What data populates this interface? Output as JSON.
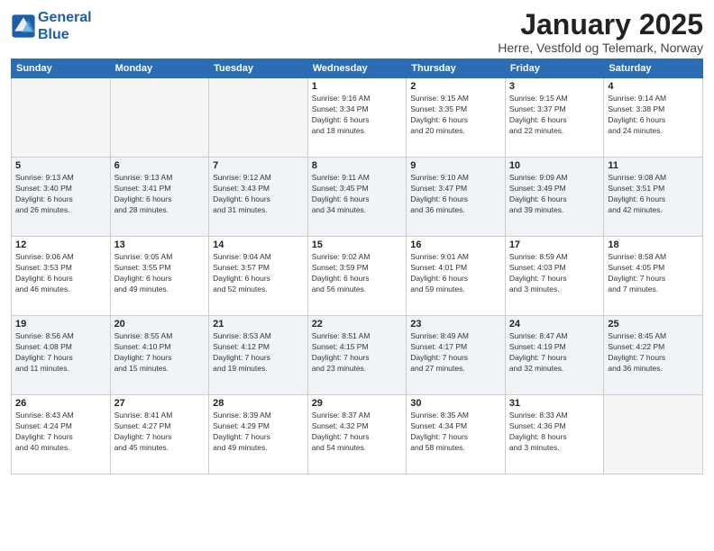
{
  "header": {
    "logo_line1": "General",
    "logo_line2": "Blue",
    "title": "January 2025",
    "subtitle": "Herre, Vestfold og Telemark, Norway"
  },
  "weekdays": [
    "Sunday",
    "Monday",
    "Tuesday",
    "Wednesday",
    "Thursday",
    "Friday",
    "Saturday"
  ],
  "weeks": [
    [
      {
        "day": "",
        "info": ""
      },
      {
        "day": "",
        "info": ""
      },
      {
        "day": "",
        "info": ""
      },
      {
        "day": "1",
        "info": "Sunrise: 9:16 AM\nSunset: 3:34 PM\nDaylight: 6 hours\nand 18 minutes."
      },
      {
        "day": "2",
        "info": "Sunrise: 9:15 AM\nSunset: 3:35 PM\nDaylight: 6 hours\nand 20 minutes."
      },
      {
        "day": "3",
        "info": "Sunrise: 9:15 AM\nSunset: 3:37 PM\nDaylight: 6 hours\nand 22 minutes."
      },
      {
        "day": "4",
        "info": "Sunrise: 9:14 AM\nSunset: 3:38 PM\nDaylight: 6 hours\nand 24 minutes."
      }
    ],
    [
      {
        "day": "5",
        "info": "Sunrise: 9:13 AM\nSunset: 3:40 PM\nDaylight: 6 hours\nand 26 minutes."
      },
      {
        "day": "6",
        "info": "Sunrise: 9:13 AM\nSunset: 3:41 PM\nDaylight: 6 hours\nand 28 minutes."
      },
      {
        "day": "7",
        "info": "Sunrise: 9:12 AM\nSunset: 3:43 PM\nDaylight: 6 hours\nand 31 minutes."
      },
      {
        "day": "8",
        "info": "Sunrise: 9:11 AM\nSunset: 3:45 PM\nDaylight: 6 hours\nand 34 minutes."
      },
      {
        "day": "9",
        "info": "Sunrise: 9:10 AM\nSunset: 3:47 PM\nDaylight: 6 hours\nand 36 minutes."
      },
      {
        "day": "10",
        "info": "Sunrise: 9:09 AM\nSunset: 3:49 PM\nDaylight: 6 hours\nand 39 minutes."
      },
      {
        "day": "11",
        "info": "Sunrise: 9:08 AM\nSunset: 3:51 PM\nDaylight: 6 hours\nand 42 minutes."
      }
    ],
    [
      {
        "day": "12",
        "info": "Sunrise: 9:06 AM\nSunset: 3:53 PM\nDaylight: 6 hours\nand 46 minutes."
      },
      {
        "day": "13",
        "info": "Sunrise: 9:05 AM\nSunset: 3:55 PM\nDaylight: 6 hours\nand 49 minutes."
      },
      {
        "day": "14",
        "info": "Sunrise: 9:04 AM\nSunset: 3:57 PM\nDaylight: 6 hours\nand 52 minutes."
      },
      {
        "day": "15",
        "info": "Sunrise: 9:02 AM\nSunset: 3:59 PM\nDaylight: 6 hours\nand 56 minutes."
      },
      {
        "day": "16",
        "info": "Sunrise: 9:01 AM\nSunset: 4:01 PM\nDaylight: 6 hours\nand 59 minutes."
      },
      {
        "day": "17",
        "info": "Sunrise: 8:59 AM\nSunset: 4:03 PM\nDaylight: 7 hours\nand 3 minutes."
      },
      {
        "day": "18",
        "info": "Sunrise: 8:58 AM\nSunset: 4:05 PM\nDaylight: 7 hours\nand 7 minutes."
      }
    ],
    [
      {
        "day": "19",
        "info": "Sunrise: 8:56 AM\nSunset: 4:08 PM\nDaylight: 7 hours\nand 11 minutes."
      },
      {
        "day": "20",
        "info": "Sunrise: 8:55 AM\nSunset: 4:10 PM\nDaylight: 7 hours\nand 15 minutes."
      },
      {
        "day": "21",
        "info": "Sunrise: 8:53 AM\nSunset: 4:12 PM\nDaylight: 7 hours\nand 19 minutes."
      },
      {
        "day": "22",
        "info": "Sunrise: 8:51 AM\nSunset: 4:15 PM\nDaylight: 7 hours\nand 23 minutes."
      },
      {
        "day": "23",
        "info": "Sunrise: 8:49 AM\nSunset: 4:17 PM\nDaylight: 7 hours\nand 27 minutes."
      },
      {
        "day": "24",
        "info": "Sunrise: 8:47 AM\nSunset: 4:19 PM\nDaylight: 7 hours\nand 32 minutes."
      },
      {
        "day": "25",
        "info": "Sunrise: 8:45 AM\nSunset: 4:22 PM\nDaylight: 7 hours\nand 36 minutes."
      }
    ],
    [
      {
        "day": "26",
        "info": "Sunrise: 8:43 AM\nSunset: 4:24 PM\nDaylight: 7 hours\nand 40 minutes."
      },
      {
        "day": "27",
        "info": "Sunrise: 8:41 AM\nSunset: 4:27 PM\nDaylight: 7 hours\nand 45 minutes."
      },
      {
        "day": "28",
        "info": "Sunrise: 8:39 AM\nSunset: 4:29 PM\nDaylight: 7 hours\nand 49 minutes."
      },
      {
        "day": "29",
        "info": "Sunrise: 8:37 AM\nSunset: 4:32 PM\nDaylight: 7 hours\nand 54 minutes."
      },
      {
        "day": "30",
        "info": "Sunrise: 8:35 AM\nSunset: 4:34 PM\nDaylight: 7 hours\nand 58 minutes."
      },
      {
        "day": "31",
        "info": "Sunrise: 8:33 AM\nSunset: 4:36 PM\nDaylight: 8 hours\nand 3 minutes."
      },
      {
        "day": "",
        "info": ""
      }
    ]
  ]
}
